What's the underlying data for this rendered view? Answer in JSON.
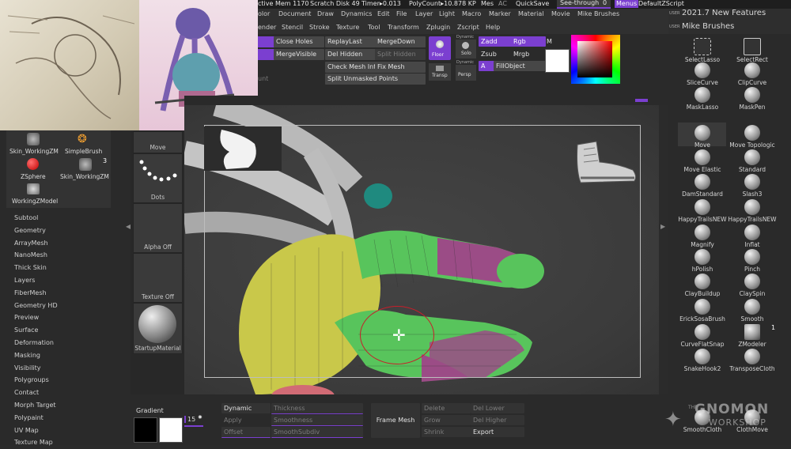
{
  "status_bar": {
    "active_mem": "ctive Mem 1170",
    "scratch_disk": "Scratch Disk 49",
    "timer": "Timer▸0.013",
    "polycount": "PolyCount▸10.878 KP",
    "mesh": "Mes",
    "ac": "AC",
    "quicksave": "QuickSave",
    "see_through": "See-through",
    "see_through_value": "0",
    "menus": "Menus",
    "default_script": "DefaultZScript"
  },
  "menu_row1": [
    "olor",
    "Document",
    "Draw",
    "Dynamics",
    "Edit",
    "File",
    "Layer",
    "Light",
    "Macro",
    "Marker",
    "Material",
    "Movie",
    "Mike Brushes"
  ],
  "menu_row2": [
    "ender",
    "Stencil",
    "Stroke",
    "Texture",
    "Tool",
    "Transform",
    "Zplugin",
    "Zscript",
    "Help"
  ],
  "right_header": {
    "user_tag": "USER",
    "title1": "2021.7 New Features",
    "user_tag2": "USER",
    "title2": "Mike Brushes"
  },
  "top_buttons": {
    "close_holes": "Close Holes",
    "merge_visible": "MergeVisible",
    "replay_last": "ReplayLast",
    "merge_down": "MergeDown",
    "del_hidden": "Del Hidden",
    "split_hidden": "Split Hidden",
    "check_mesh_int": "Check Mesh Inte",
    "fix_mesh": "Fix Mesh",
    "split_unmasked": "Split Unmasked Points",
    "floor": "Floor",
    "transp": "Transp",
    "dynamic": "Dynamic",
    "solo": "Solo",
    "persp": "Persp",
    "zadd": "Zadd",
    "rgb": "Rgb",
    "m": "M",
    "zsub": "Zsub",
    "mrgb": "Mrgb",
    "a": "A",
    "fill_object": "FillObject",
    "unt": "unt"
  },
  "left_tools": {
    "items": [
      "Skin_WorkingZM",
      "SimpleBrush",
      "ZSphere",
      "Skin_WorkingZM",
      "WorkingZModel"
    ],
    "count_badge": "3"
  },
  "tool_subpalettes": [
    "Subtool",
    "Geometry",
    "ArrayMesh",
    "NanoMesh",
    "Thick Skin",
    "Layers",
    "FiberMesh",
    "Geometry HD",
    "Preview",
    "Surface",
    "Deformation",
    "Masking",
    "Visibility",
    "Polygroups",
    "Contact",
    "Morph Target",
    "Polypaint",
    "UV Map",
    "Texture Map"
  ],
  "shelf": {
    "move": "Move",
    "dots": "Dots",
    "alpha_off": "Alpha Off",
    "texture_off": "Texture Off",
    "startup_material": "StartupMaterial",
    "gradient": "Gradient"
  },
  "brushes": [
    [
      "SelectLasso",
      "SelectRect"
    ],
    [
      "SliceCurve",
      "ClipCurve"
    ],
    [
      "MaskLasso",
      "MaskPen"
    ],
    [
      "Move",
      "Move Topologic"
    ],
    [
      "Move Elastic",
      "Standard"
    ],
    [
      "DamStandard",
      "Slash3"
    ],
    [
      "HappyTrailsNEW",
      "HappyTrailsNEW"
    ],
    [
      "Magnify",
      "Inflat"
    ],
    [
      "hPolish",
      "Pinch"
    ],
    [
      "ClayBuildup",
      "ClaySpin"
    ],
    [
      "ErickSosaBrush",
      "Smooth"
    ],
    [
      "CurveFlatSnap",
      "ZModeler"
    ],
    [
      "SnakeHook2",
      "TransposeCloth"
    ],
    [
      "SmoothCloth",
      "ClothMove"
    ]
  ],
  "zmodeler_badge": "1",
  "bottom_panel": {
    "size_value": "15",
    "dynamic": "Dynamic",
    "thickness": "Thickness",
    "apply": "Apply",
    "smoothness": "Smoothness",
    "offset": "Offset",
    "smooth_subdiv": "SmoothSubdiv",
    "frame_mesh": "Frame Mesh",
    "delete": "Delete",
    "grow": "Grow",
    "shrink": "Shrink",
    "del_lower": "Del Lower",
    "del_higher": "Del Higher",
    "export": "Export"
  },
  "watermark": {
    "the": "THE",
    "gnomon": "GNOMON",
    "workshop": "WORKSHOP"
  },
  "colors": {
    "accent": "#7b3fd0",
    "background": "#2b2b2b",
    "canvas": "#3e3e3e",
    "mesh_yellow": "#c9c84a",
    "mesh_green": "#58c45c",
    "mesh_magenta": "#9b4c86"
  }
}
